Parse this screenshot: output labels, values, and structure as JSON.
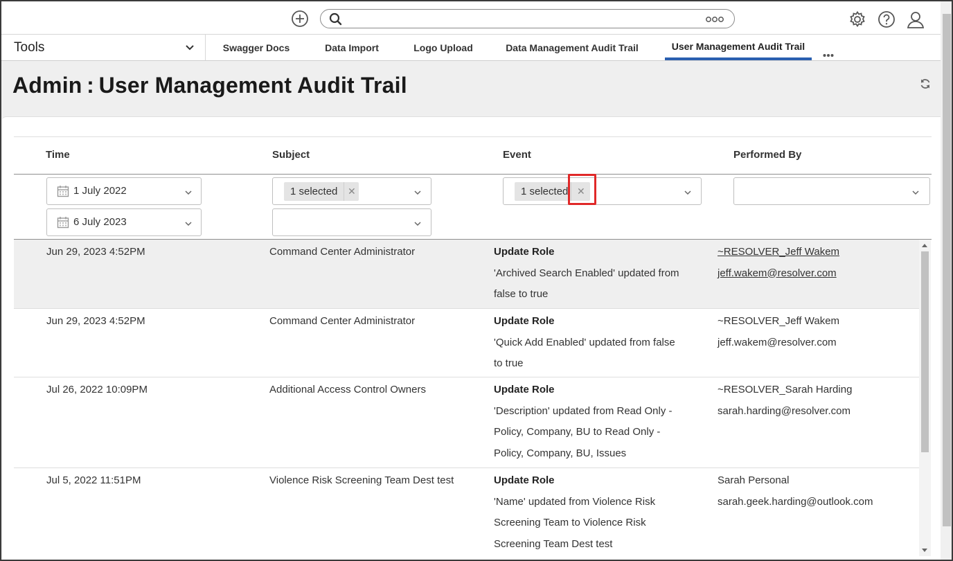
{
  "topbar": {
    "search": {
      "placeholder": "",
      "value": ""
    }
  },
  "nav": {
    "tools_label": "Tools",
    "tabs": [
      {
        "label": "Swagger Docs"
      },
      {
        "label": "Data Import"
      },
      {
        "label": "Logo Upload"
      },
      {
        "label": "Data Management Audit Trail"
      },
      {
        "label": "User Management Audit Trail",
        "active": true
      }
    ]
  },
  "header": {
    "title": "Admin : User Management Audit Trail"
  },
  "table": {
    "columns": [
      "Time",
      "Subject",
      "Event",
      "Performed By"
    ],
    "filters": {
      "time_from": "1 July 2022",
      "time_to": "6 July 2023",
      "subject_chip": "1 selected",
      "event_chip": "1 selected"
    },
    "rows": [
      {
        "time": "Jun 29, 2023 4:52PM",
        "subject": "Command Center Administrator",
        "event_title": "Update Role",
        "event_lines": [
          "'Archived Search Enabled' updated from",
          "false to true"
        ],
        "by_name": "~RESOLVER_Jeff Wakem",
        "by_email": "jeff.wakem@resolver.com"
      },
      {
        "time": "Jun 29, 2023 4:52PM",
        "subject": "Command Center Administrator",
        "event_title": "Update Role",
        "event_lines": [
          "'Quick Add Enabled' updated from false",
          "to true"
        ],
        "by_name": "~RESOLVER_Jeff Wakem",
        "by_email": "jeff.wakem@resolver.com"
      },
      {
        "time": "Jul 26, 2022 10:09PM",
        "subject": "Additional Access Control Owners",
        "event_title": "Update Role",
        "event_lines": [
          "'Description' updated from Read Only -",
          "Policy, Company, BU to Read Only -",
          "Policy, Company, BU, Issues"
        ],
        "by_name": "~RESOLVER_Sarah Harding",
        "by_email": "sarah.harding@resolver.com"
      },
      {
        "time": "Jul 5, 2022 11:51PM",
        "subject": "Violence Risk Screening Team Dest test",
        "event_title": "Update Role",
        "event_lines": [
          "'Name' updated from Violence Risk",
          "Screening Team to Violence Risk",
          "Screening Team Dest test"
        ],
        "by_name": "Sarah Personal",
        "by_email": "sarah.geek.harding@outlook.com"
      }
    ]
  },
  "colors": {
    "accent": "#2a5fb0",
    "highlight": "#e02828",
    "header_bg": "#efefef"
  },
  "icons": [
    "add-icon",
    "search-icon",
    "more-icon",
    "gear-icon",
    "help-icon",
    "user-icon",
    "chevron-down-icon",
    "refresh-icon",
    "calendar-icon",
    "close-icon"
  ]
}
